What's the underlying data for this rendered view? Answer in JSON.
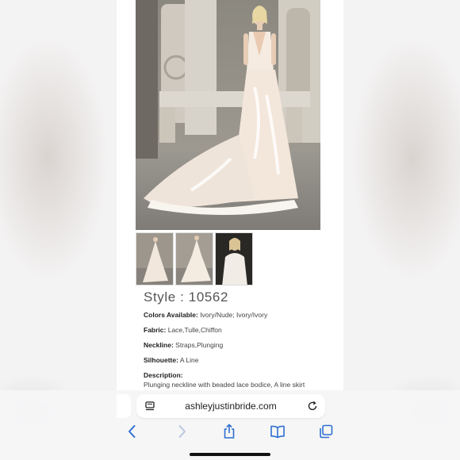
{
  "product": {
    "style_title": "Style : 10562",
    "colors_label": "Colors Available:",
    "colors_value": "Ivory/Nude; Ivory/Ivory",
    "fabric_label": "Fabric:",
    "fabric_value": "Lace,Tulle,Chiffon",
    "neckline_label": "Neckline:",
    "neckline_value": "Straps,Plunging",
    "silhouette_label": "Silhouette:",
    "silhouette_value": "A Line",
    "description_label": "Description:",
    "description_value": "Plunging neckline with beaded lace bodice, A line skirt"
  },
  "browser": {
    "url": "ashleyjustinbride.com",
    "icons": [
      "back-icon",
      "forward-icon",
      "share-icon",
      "bookmarks-icon",
      "tabs-icon",
      "reader-icon",
      "reload-icon"
    ]
  },
  "colors": {
    "page_bg": "#ffffff",
    "toolbar_bg": "#f6f6f7",
    "accent": "#2f6fd1"
  }
}
